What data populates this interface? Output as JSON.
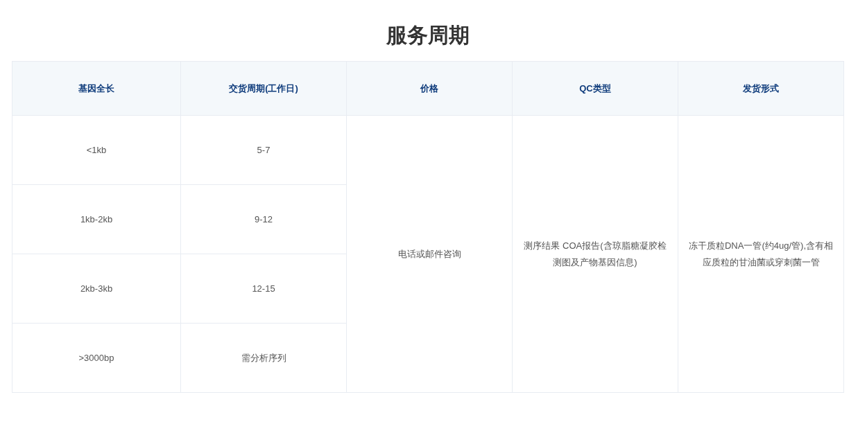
{
  "title": "服务周期",
  "table": {
    "columns": [
      "基因全长",
      "交货周期(工作日)",
      "价格",
      "QC类型",
      "发货形式"
    ],
    "rows": [
      {
        "gene_length": "<1kb",
        "delivery": "5-7"
      },
      {
        "gene_length": "1kb-2kb",
        "delivery": "9-12"
      },
      {
        "gene_length": "2kb-3kb",
        "delivery": "12-15"
      },
      {
        "gene_length": ">3000bp",
        "delivery": "需分析序列"
      }
    ],
    "merged": {
      "price": "电话或邮件咨询",
      "qc_type": "测序结果 COA报告(含琼脂糖凝胶检测图及产物基因信息)",
      "shipping": "冻干质粒DNA一管(约4ug/管),含有相应质粒的甘油菌或穿刺菌一管"
    }
  }
}
